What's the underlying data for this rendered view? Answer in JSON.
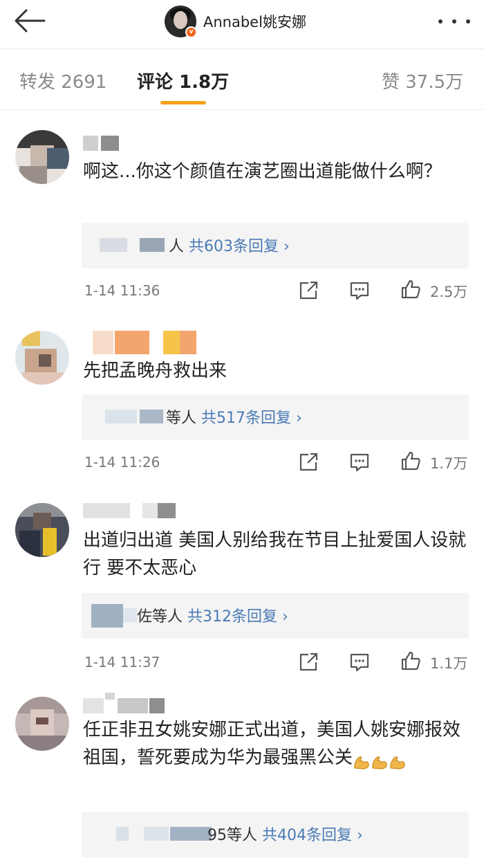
{
  "navbar": {
    "title": "Annabel姚安娜"
  },
  "tabs": {
    "repost": "转发 2691",
    "comments": "评论 1.8万",
    "likes": "赞 37.5万"
  },
  "comments": [
    {
      "text": "啊这...你这个颜值在演艺圈出道能做什么啊？",
      "reply_suffix": "人",
      "reply_count": "共603条回复",
      "time": "1-14 11:36",
      "likes": "2.5万"
    },
    {
      "text": "先把孟晚舟救出来",
      "reply_suffix": "等人",
      "reply_count": "共517条回复",
      "time": "1-14 11:26",
      "likes": "1.7万"
    },
    {
      "text": "出道归出道 美国人别给我在节目上扯爱国人设就行 要不太恶心",
      "reply_suffix": "佐等人",
      "reply_count": "共312条回复",
      "time": "1-14 11:37",
      "likes": "1.1万"
    },
    {
      "text": "任正非丑女姚安娜正式出道，美国人姚安娜报效祖国，誓死要成为华为最强黑公关",
      "reply_suffix": "95等人",
      "reply_count": "共404条回复"
    }
  ],
  "colors": {
    "accent": "#f7a21b",
    "link": "#4a7ab5",
    "verified": "#f0641e"
  },
  "icons": [
    "back-arrow-icon",
    "more-icon",
    "share-icon",
    "comment-icon",
    "like-icon",
    "flexed-biceps-emoji"
  ]
}
